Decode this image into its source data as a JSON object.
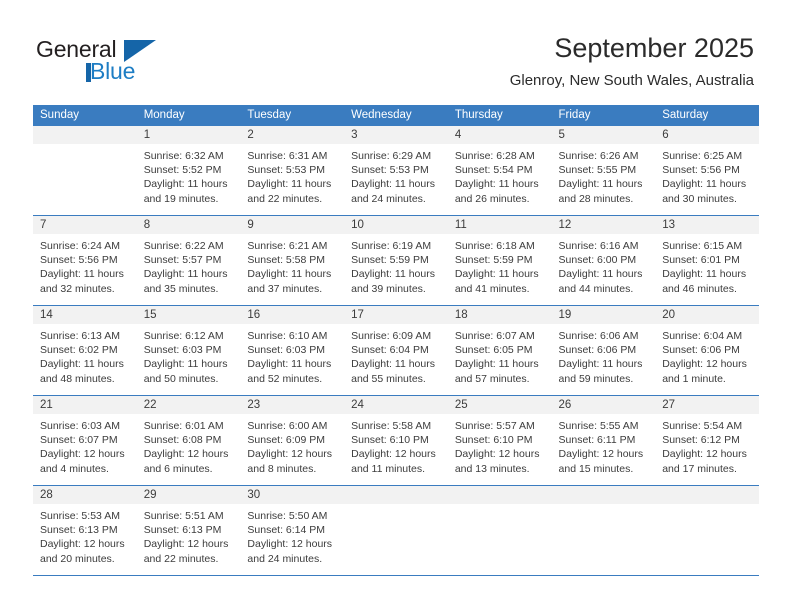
{
  "brand": {
    "name_part1": "General",
    "name_part2": "Blue"
  },
  "header": {
    "title": "September 2025",
    "subtitle": "Glenroy, New South Wales, Australia"
  },
  "colors": {
    "header_blue": "#3a7cc0",
    "logo_blue": "#1d7dc4",
    "daynum_bg": "#f2f2f2",
    "text": "#3c3c3c"
  },
  "weekday_headers": [
    "Sunday",
    "Monday",
    "Tuesday",
    "Wednesday",
    "Thursday",
    "Friday",
    "Saturday"
  ],
  "weeks": [
    [
      {
        "day": ""
      },
      {
        "day": "1",
        "sunrise": "Sunrise: 6:32 AM",
        "sunset": "Sunset: 5:52 PM",
        "daylight1": "Daylight: 11 hours",
        "daylight2": "and 19 minutes."
      },
      {
        "day": "2",
        "sunrise": "Sunrise: 6:31 AM",
        "sunset": "Sunset: 5:53 PM",
        "daylight1": "Daylight: 11 hours",
        "daylight2": "and 22 minutes."
      },
      {
        "day": "3",
        "sunrise": "Sunrise: 6:29 AM",
        "sunset": "Sunset: 5:53 PM",
        "daylight1": "Daylight: 11 hours",
        "daylight2": "and 24 minutes."
      },
      {
        "day": "4",
        "sunrise": "Sunrise: 6:28 AM",
        "sunset": "Sunset: 5:54 PM",
        "daylight1": "Daylight: 11 hours",
        "daylight2": "and 26 minutes."
      },
      {
        "day": "5",
        "sunrise": "Sunrise: 6:26 AM",
        "sunset": "Sunset: 5:55 PM",
        "daylight1": "Daylight: 11 hours",
        "daylight2": "and 28 minutes."
      },
      {
        "day": "6",
        "sunrise": "Sunrise: 6:25 AM",
        "sunset": "Sunset: 5:56 PM",
        "daylight1": "Daylight: 11 hours",
        "daylight2": "and 30 minutes."
      }
    ],
    [
      {
        "day": "7",
        "sunrise": "Sunrise: 6:24 AM",
        "sunset": "Sunset: 5:56 PM",
        "daylight1": "Daylight: 11 hours",
        "daylight2": "and 32 minutes."
      },
      {
        "day": "8",
        "sunrise": "Sunrise: 6:22 AM",
        "sunset": "Sunset: 5:57 PM",
        "daylight1": "Daylight: 11 hours",
        "daylight2": "and 35 minutes."
      },
      {
        "day": "9",
        "sunrise": "Sunrise: 6:21 AM",
        "sunset": "Sunset: 5:58 PM",
        "daylight1": "Daylight: 11 hours",
        "daylight2": "and 37 minutes."
      },
      {
        "day": "10",
        "sunrise": "Sunrise: 6:19 AM",
        "sunset": "Sunset: 5:59 PM",
        "daylight1": "Daylight: 11 hours",
        "daylight2": "and 39 minutes."
      },
      {
        "day": "11",
        "sunrise": "Sunrise: 6:18 AM",
        "sunset": "Sunset: 5:59 PM",
        "daylight1": "Daylight: 11 hours",
        "daylight2": "and 41 minutes."
      },
      {
        "day": "12",
        "sunrise": "Sunrise: 6:16 AM",
        "sunset": "Sunset: 6:00 PM",
        "daylight1": "Daylight: 11 hours",
        "daylight2": "and 44 minutes."
      },
      {
        "day": "13",
        "sunrise": "Sunrise: 6:15 AM",
        "sunset": "Sunset: 6:01 PM",
        "daylight1": "Daylight: 11 hours",
        "daylight2": "and 46 minutes."
      }
    ],
    [
      {
        "day": "14",
        "sunrise": "Sunrise: 6:13 AM",
        "sunset": "Sunset: 6:02 PM",
        "daylight1": "Daylight: 11 hours",
        "daylight2": "and 48 minutes."
      },
      {
        "day": "15",
        "sunrise": "Sunrise: 6:12 AM",
        "sunset": "Sunset: 6:03 PM",
        "daylight1": "Daylight: 11 hours",
        "daylight2": "and 50 minutes."
      },
      {
        "day": "16",
        "sunrise": "Sunrise: 6:10 AM",
        "sunset": "Sunset: 6:03 PM",
        "daylight1": "Daylight: 11 hours",
        "daylight2": "and 52 minutes."
      },
      {
        "day": "17",
        "sunrise": "Sunrise: 6:09 AM",
        "sunset": "Sunset: 6:04 PM",
        "daylight1": "Daylight: 11 hours",
        "daylight2": "and 55 minutes."
      },
      {
        "day": "18",
        "sunrise": "Sunrise: 6:07 AM",
        "sunset": "Sunset: 6:05 PM",
        "daylight1": "Daylight: 11 hours",
        "daylight2": "and 57 minutes."
      },
      {
        "day": "19",
        "sunrise": "Sunrise: 6:06 AM",
        "sunset": "Sunset: 6:06 PM",
        "daylight1": "Daylight: 11 hours",
        "daylight2": "and 59 minutes."
      },
      {
        "day": "20",
        "sunrise": "Sunrise: 6:04 AM",
        "sunset": "Sunset: 6:06 PM",
        "daylight1": "Daylight: 12 hours",
        "daylight2": "and 1 minute."
      }
    ],
    [
      {
        "day": "21",
        "sunrise": "Sunrise: 6:03 AM",
        "sunset": "Sunset: 6:07 PM",
        "daylight1": "Daylight: 12 hours",
        "daylight2": "and 4 minutes."
      },
      {
        "day": "22",
        "sunrise": "Sunrise: 6:01 AM",
        "sunset": "Sunset: 6:08 PM",
        "daylight1": "Daylight: 12 hours",
        "daylight2": "and 6 minutes."
      },
      {
        "day": "23",
        "sunrise": "Sunrise: 6:00 AM",
        "sunset": "Sunset: 6:09 PM",
        "daylight1": "Daylight: 12 hours",
        "daylight2": "and 8 minutes."
      },
      {
        "day": "24",
        "sunrise": "Sunrise: 5:58 AM",
        "sunset": "Sunset: 6:10 PM",
        "daylight1": "Daylight: 12 hours",
        "daylight2": "and 11 minutes."
      },
      {
        "day": "25",
        "sunrise": "Sunrise: 5:57 AM",
        "sunset": "Sunset: 6:10 PM",
        "daylight1": "Daylight: 12 hours",
        "daylight2": "and 13 minutes."
      },
      {
        "day": "26",
        "sunrise": "Sunrise: 5:55 AM",
        "sunset": "Sunset: 6:11 PM",
        "daylight1": "Daylight: 12 hours",
        "daylight2": "and 15 minutes."
      },
      {
        "day": "27",
        "sunrise": "Sunrise: 5:54 AM",
        "sunset": "Sunset: 6:12 PM",
        "daylight1": "Daylight: 12 hours",
        "daylight2": "and 17 minutes."
      }
    ],
    [
      {
        "day": "28",
        "sunrise": "Sunrise: 5:53 AM",
        "sunset": "Sunset: 6:13 PM",
        "daylight1": "Daylight: 12 hours",
        "daylight2": "and 20 minutes."
      },
      {
        "day": "29",
        "sunrise": "Sunrise: 5:51 AM",
        "sunset": "Sunset: 6:13 PM",
        "daylight1": "Daylight: 12 hours",
        "daylight2": "and 22 minutes."
      },
      {
        "day": "30",
        "sunrise": "Sunrise: 5:50 AM",
        "sunset": "Sunset: 6:14 PM",
        "daylight1": "Daylight: 12 hours",
        "daylight2": "and 24 minutes."
      },
      {
        "day": ""
      },
      {
        "day": ""
      },
      {
        "day": ""
      },
      {
        "day": ""
      }
    ]
  ]
}
